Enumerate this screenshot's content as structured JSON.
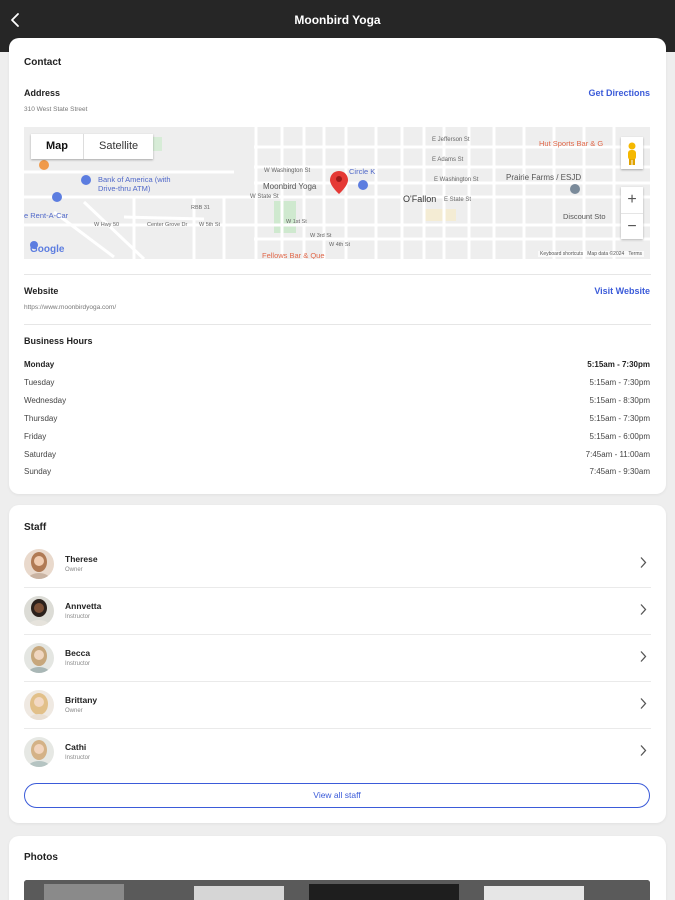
{
  "header": {
    "title": "Moonbird Yoga"
  },
  "contact": {
    "title": "Contact",
    "address_label": "Address",
    "address": "310 West State Street",
    "directions_label": "Get Directions",
    "map": {
      "tab_map": "Map",
      "tab_satellite": "Satellite",
      "zoom_in": "+",
      "zoom_out": "−",
      "place_name": "Moonbird Yoga",
      "labels": {
        "bank": "Bank of America (with",
        "bank2": "Drive-thru ATM)",
        "circle_k": "Circle K",
        "hut": "Hut Sports Bar & G",
        "prairie": "Prairie Farms / ESJD",
        "ofallon": "O'Fallon",
        "discount": "Discount Sto",
        "rent": "e Rent-A-Car",
        "jefferson": "E Jefferson St",
        "adams": "E Adams St",
        "washington": "E Washington St",
        "w_washington": "W Washington St",
        "state": "E State St",
        "w_state": "W State St",
        "center_grove": "Center Grove Dr",
        "rbb": "RBB 31",
        "w_5th": "W 5th St",
        "w_1st": "W 1st St",
        "w_3rd": "W 3rd St",
        "w_4th": "W 4th St",
        "w_hwy": "W Hwy 50",
        "fellows": "Fellows Bar & Que",
        "google": "Google",
        "shortcuts": "Keyboard shortcuts",
        "mapdata": "Map data ©2024",
        "terms": "Terms"
      }
    },
    "website_label": "Website",
    "website_url": "https://www.moonbirdyoga.com/",
    "visit_website_label": "Visit Website",
    "hours_label": "Business Hours",
    "hours": [
      {
        "day": "Monday",
        "time": "5:15am - 7:30pm"
      },
      {
        "day": "Tuesday",
        "time": "5:15am - 7:30pm"
      },
      {
        "day": "Wednesday",
        "time": "5:15am - 8:30pm"
      },
      {
        "day": "Thursday",
        "time": "5:15am - 7:30pm"
      },
      {
        "day": "Friday",
        "time": "5:15am - 6:00pm"
      },
      {
        "day": "Saturday",
        "time": "7:45am - 11:00am"
      },
      {
        "day": "Sunday",
        "time": "7:45am - 9:30am"
      }
    ]
  },
  "staff": {
    "title": "Staff",
    "members": [
      {
        "name": "Therese",
        "role": "Owner"
      },
      {
        "name": "Annvetta",
        "role": "Instructor"
      },
      {
        "name": "Becca",
        "role": "Instructor"
      },
      {
        "name": "Brittany",
        "role": "Owner"
      },
      {
        "name": "Cathi",
        "role": "Instructor"
      }
    ],
    "view_all_label": "View all staff"
  },
  "photos": {
    "title": "Photos"
  },
  "colors": {
    "accent": "#3b5bd9",
    "header_bg": "#262626",
    "pin": "#e53935"
  }
}
